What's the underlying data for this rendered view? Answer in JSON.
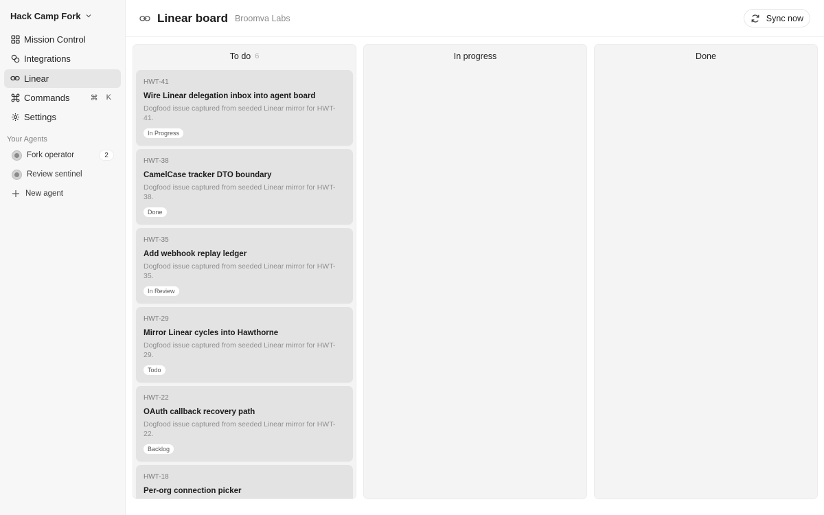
{
  "workspace": {
    "name": "Hack Camp Fork"
  },
  "sidebar": {
    "items": [
      {
        "label": "Mission Control",
        "icon": "grid-icon"
      },
      {
        "label": "Integrations",
        "icon": "integrations-icon"
      },
      {
        "label": "Linear",
        "icon": "link-icon",
        "active": true
      },
      {
        "label": "Commands",
        "icon": "command-icon",
        "shortcut": [
          "⌘",
          "K"
        ]
      },
      {
        "label": "Settings",
        "icon": "gear-icon"
      }
    ],
    "agents_label": "Your Agents",
    "agents": [
      {
        "name": "Fork operator",
        "count": "2"
      },
      {
        "name": "Review sentinel"
      }
    ],
    "new_agent_label": "New agent"
  },
  "header": {
    "title": "Linear board",
    "subtitle": "Broomva Labs",
    "sync_label": "Sync now"
  },
  "board": {
    "columns": [
      {
        "title": "To do",
        "count": "6",
        "cards": [
          {
            "key": "HWT-41",
            "title": "Wire Linear delegation inbox into agent board",
            "desc": "Dogfood issue captured from seeded Linear mirror for HWT-41.",
            "status": "In Progress"
          },
          {
            "key": "HWT-38",
            "title": "CamelCase tracker DTO boundary",
            "desc": "Dogfood issue captured from seeded Linear mirror for HWT-38.",
            "status": "Done"
          },
          {
            "key": "HWT-35",
            "title": "Add webhook replay ledger",
            "desc": "Dogfood issue captured from seeded Linear mirror for HWT-35.",
            "status": "In Review"
          },
          {
            "key": "HWT-29",
            "title": "Mirror Linear cycles into Hawthorne",
            "desc": "Dogfood issue captured from seeded Linear mirror for HWT-29.",
            "status": "Todo"
          },
          {
            "key": "HWT-22",
            "title": "OAuth callback recovery path",
            "desc": "Dogfood issue captured from seeded Linear mirror for HWT-22.",
            "status": "Backlog"
          },
          {
            "key": "HWT-18",
            "title": "Per-org connection picker",
            "desc": "",
            "status": ""
          }
        ]
      },
      {
        "title": "In progress",
        "cards": []
      },
      {
        "title": "Done",
        "cards": []
      }
    ]
  },
  "colors": {
    "sidebar_bg": "#f7f7f7",
    "column_bg": "#f4f4f4",
    "card_bg": "#e3e3e3",
    "active_item_bg": "#e6e6e6"
  }
}
